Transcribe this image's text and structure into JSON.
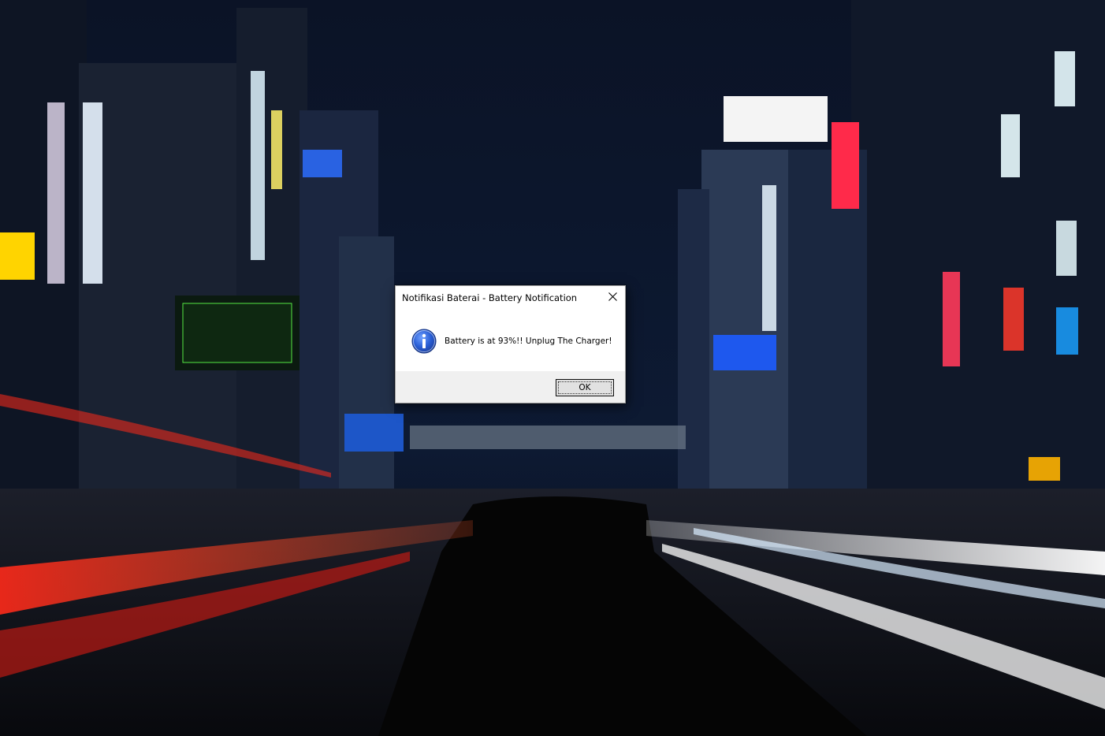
{
  "desktop": {
    "wallpaper_description_icon": "night-city-street-wallpaper"
  },
  "dialog": {
    "title": "Notifikasi Baterai - Battery Notification",
    "message": "Battery is at 93%!! Unplug The Charger!",
    "icon": "information-icon",
    "ok_label": "OK",
    "close_icon": "close-icon",
    "colors": {
      "icon_blue": "#1f4fbf",
      "footer_bg": "#f0f0f0",
      "button_bg": "#e1e1e1"
    }
  }
}
